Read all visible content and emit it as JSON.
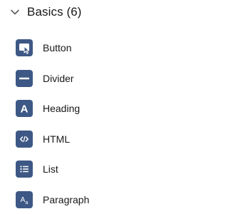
{
  "section": {
    "title": "Basics (6)",
    "expanded": true,
    "chevron_icon": "chevron-down-icon"
  },
  "colors": {
    "icon_tile": "#3e5885",
    "icon_glyph": "#ffffff",
    "text": "#181818",
    "chevron": "#5c5c5c"
  },
  "items": [
    {
      "label": "Button",
      "icon": "button-icon"
    },
    {
      "label": "Divider",
      "icon": "divider-icon"
    },
    {
      "label": "Heading",
      "icon": "heading-icon"
    },
    {
      "label": "HTML",
      "icon": "html-code-icon"
    },
    {
      "label": "List",
      "icon": "list-icon"
    },
    {
      "label": "Paragraph",
      "icon": "paragraph-icon"
    }
  ]
}
